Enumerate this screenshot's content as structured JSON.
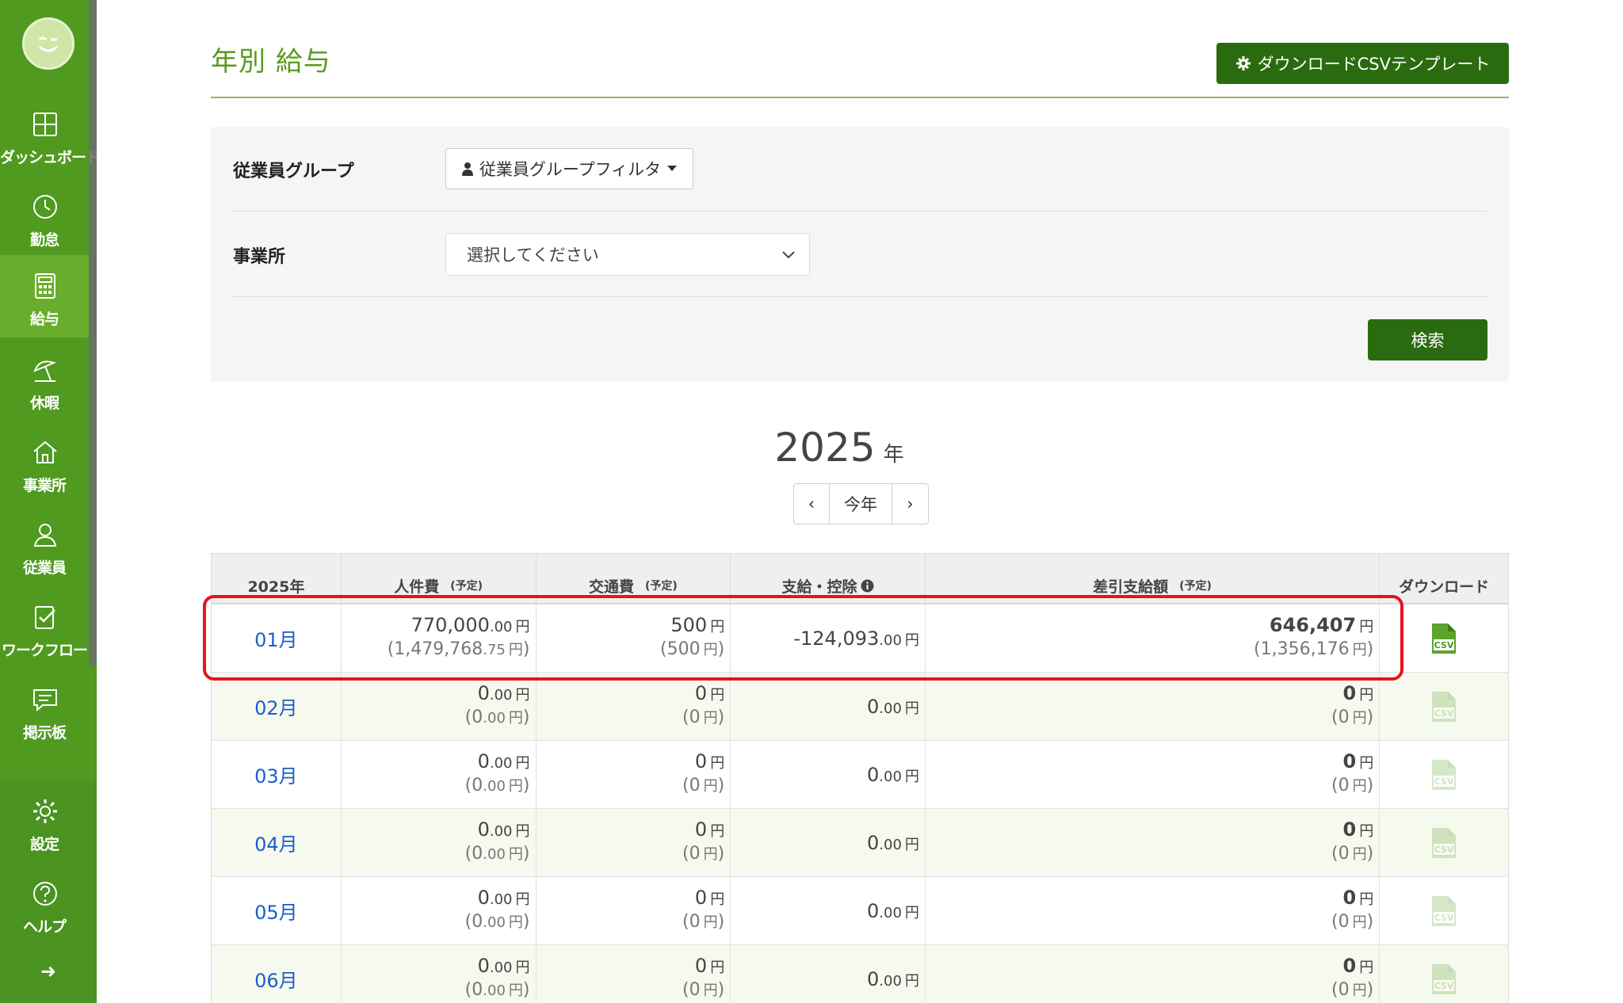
{
  "sidebar": {
    "items": [
      {
        "id": "dashboard",
        "label": "ダッシュボード",
        "icon": "grid-icon",
        "active": false
      },
      {
        "id": "attendance",
        "label": "勤怠",
        "icon": "clock-icon",
        "active": false
      },
      {
        "id": "payroll",
        "label": "給与",
        "icon": "calculator-icon",
        "active": true
      },
      {
        "id": "leave",
        "label": "休暇",
        "icon": "beach-umbrella-icon",
        "active": false
      },
      {
        "id": "office",
        "label": "事業所",
        "icon": "home-icon",
        "active": false
      },
      {
        "id": "employees",
        "label": "従業員",
        "icon": "person-icon",
        "active": false
      },
      {
        "id": "workflow",
        "label": "ワークフロー",
        "icon": "clipboard-check-icon",
        "active": false
      },
      {
        "id": "board",
        "label": "掲示板",
        "icon": "chat-icon",
        "active": false
      }
    ],
    "bottom": [
      {
        "id": "settings",
        "label": "設定",
        "icon": "gear-icon"
      },
      {
        "id": "help",
        "label": "ヘルプ",
        "icon": "question-circle-icon"
      }
    ],
    "expand_icon": "arrow-right-icon"
  },
  "header": {
    "title": "年別 給与",
    "download_template_label": "ダウンロードCSVテンプレート"
  },
  "filters": {
    "group_label": "従業員グループ",
    "group_button": "従業員グループフィルタ",
    "office_label": "事業所",
    "office_placeholder": "選択してください",
    "search_label": "検索"
  },
  "year": {
    "value": "2025",
    "unit": "年",
    "prev": "‹",
    "current_label": "今年",
    "next": "›"
  },
  "table": {
    "headers": {
      "year": "2025年",
      "labor": "人件費",
      "labor_note": "(予定)",
      "transport": "交通費",
      "transport_note": "(予定)",
      "payment": "支給・控除",
      "net": "差引支給額",
      "net_note": "(予定)",
      "download": "ダウンロード"
    },
    "yen": "円",
    "rows": [
      {
        "month": "01月",
        "labor_int": "770,000",
        "labor_dec": ".00",
        "labor_sub_int": "(1,479,768",
        "labor_sub_dec": ".75",
        "transport": "500",
        "transport_sub": "(500",
        "payment_int": "-124,093",
        "payment_dec": ".00",
        "net": "646,407",
        "net_sub": "(1,356,176",
        "csv_active": true
      },
      {
        "month": "02月",
        "labor_int": "0",
        "labor_dec": ".00",
        "labor_sub_int": "(0",
        "labor_sub_dec": ".00",
        "transport": "0",
        "transport_sub": "(0",
        "payment_int": "0",
        "payment_dec": ".00",
        "net": "0",
        "net_sub": "(0",
        "csv_active": false
      },
      {
        "month": "03月",
        "labor_int": "0",
        "labor_dec": ".00",
        "labor_sub_int": "(0",
        "labor_sub_dec": ".00",
        "transport": "0",
        "transport_sub": "(0",
        "payment_int": "0",
        "payment_dec": ".00",
        "net": "0",
        "net_sub": "(0",
        "csv_active": false
      },
      {
        "month": "04月",
        "labor_int": "0",
        "labor_dec": ".00",
        "labor_sub_int": "(0",
        "labor_sub_dec": ".00",
        "transport": "0",
        "transport_sub": "(0",
        "payment_int": "0",
        "payment_dec": ".00",
        "net": "0",
        "net_sub": "(0",
        "csv_active": false
      },
      {
        "month": "05月",
        "labor_int": "0",
        "labor_dec": ".00",
        "labor_sub_int": "(0",
        "labor_sub_dec": ".00",
        "transport": "0",
        "transport_sub": "(0",
        "payment_int": "0",
        "payment_dec": ".00",
        "net": "0",
        "net_sub": "(0",
        "csv_active": false
      },
      {
        "month": "06月",
        "labor_int": "0",
        "labor_dec": ".00",
        "labor_sub_int": "(0",
        "labor_sub_dec": ".00",
        "transport": "0",
        "transport_sub": "(0",
        "payment_int": "0",
        "payment_dec": ".00",
        "net": "0",
        "net_sub": "(0",
        "csv_active": false
      }
    ]
  },
  "colors": {
    "sidebar": "#4f9a1f",
    "sidebar_active": "#68ad2b",
    "primary_button": "#2b6b10",
    "title": "#5a9a1e",
    "link": "#1a5ec9",
    "highlight": "#e5141e"
  }
}
